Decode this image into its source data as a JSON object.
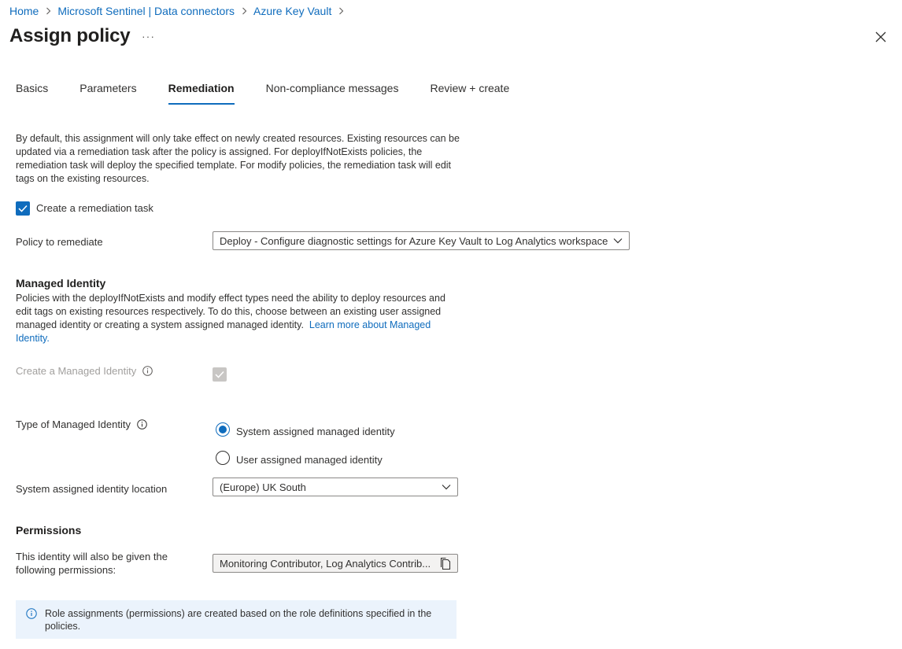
{
  "breadcrumb": [
    "Home",
    "Microsoft Sentinel | Data connectors",
    "Azure Key Vault"
  ],
  "title": "Assign policy",
  "more_label": "···",
  "tabs": [
    {
      "label": "Basics"
    },
    {
      "label": "Parameters"
    },
    {
      "label": "Remediation",
      "active": true
    },
    {
      "label": "Non-compliance messages"
    },
    {
      "label": "Review + create"
    }
  ],
  "intro_text": "By default, this assignment will only take effect on newly created resources. Existing resources can be updated via a remediation task after the policy is assigned. For deployIfNotExists policies, the remediation task will deploy the specified template. For modify policies, the remediation task will edit tags on the existing resources.",
  "remediation_task": {
    "label": "Create a remediation task",
    "checked": true
  },
  "policy_to_remediate": {
    "label": "Policy to remediate",
    "value": "Deploy - Configure diagnostic settings for Azure Key Vault to Log Analytics workspace"
  },
  "managed_identity": {
    "title": "Managed Identity",
    "description": "Policies with the deployIfNotExists and modify effect types need the ability to deploy resources and edit tags on existing resources respectively. To do this, choose between an existing user assigned managed identity or creating a system assigned managed identity.",
    "learn_more": "Learn more about Managed Identity.",
    "create_label": "Create a Managed Identity",
    "create_checked": true,
    "type_label": "Type of Managed Identity",
    "type_options": [
      {
        "label": "System assigned managed identity",
        "selected": true
      },
      {
        "label": "User assigned managed identity",
        "selected": false
      }
    ],
    "location_label": "System assigned identity location",
    "location_value": "(Europe) UK South"
  },
  "permissions": {
    "title": "Permissions",
    "label": "This identity will also be given the following permissions:",
    "value": "Monitoring Contributor, Log Analytics Contrib..."
  },
  "info_bar": {
    "text": "Role assignments (permissions) are created based on the role definitions specified in the policies."
  },
  "colors": {
    "accent": "#0f6cbd",
    "info_bg": "#ebf3fc",
    "disabled": "#c8c6c4"
  }
}
